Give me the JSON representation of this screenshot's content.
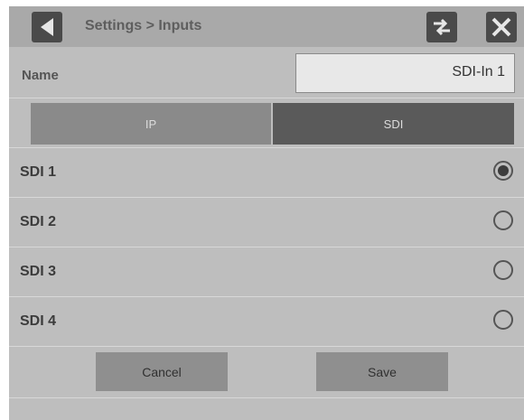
{
  "header": {
    "title": "Settings > Inputs"
  },
  "name_field": {
    "label": "Name",
    "value": "SDI-In 1"
  },
  "tabs": [
    {
      "label": "IP",
      "selected": false
    },
    {
      "label": "SDI",
      "selected": true
    }
  ],
  "inputs": [
    {
      "label": "SDI 1",
      "selected": true
    },
    {
      "label": "SDI 2",
      "selected": false
    },
    {
      "label": "SDI 3",
      "selected": false
    },
    {
      "label": "SDI 4",
      "selected": false
    }
  ],
  "actions": {
    "cancel_label": "Cancel",
    "save_label": "Save"
  },
  "icons": {
    "back": "back-arrow-icon",
    "swap": "swap-icon",
    "close": "close-icon"
  }
}
